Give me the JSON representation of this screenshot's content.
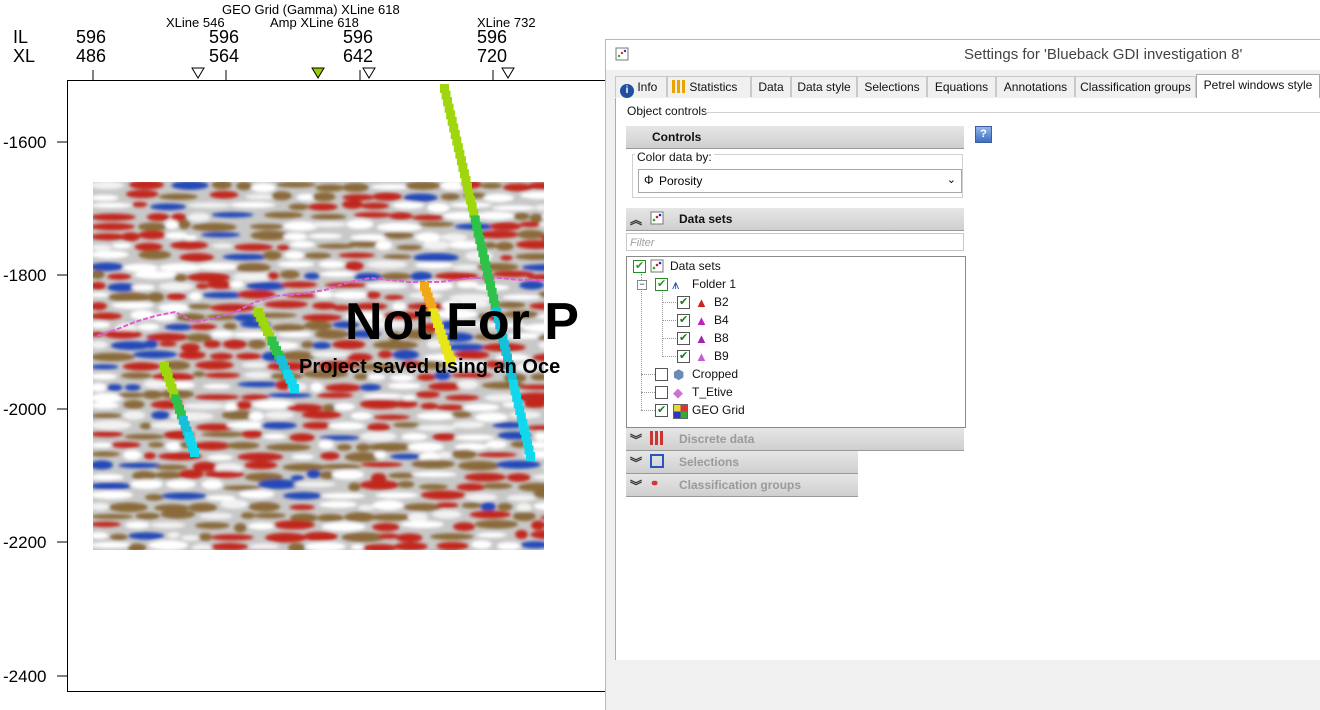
{
  "viewer": {
    "header": {
      "il_label": "IL",
      "xl_label": "XL",
      "columns": [
        {
          "il": "596",
          "xl": "486"
        },
        {
          "il": "596",
          "xl": "564"
        },
        {
          "il": "596",
          "xl": "642"
        },
        {
          "il": "596",
          "xl": "720"
        }
      ],
      "titles": {
        "geo_grid": "GEO Grid (Gamma) XLine 618",
        "xline_546": "XLine 546",
        "amp_xline": "Amp XLine 618",
        "xline_732": "XLine 732"
      }
    },
    "y_axis": {
      "ticks": [
        "-1600",
        "-1800",
        "-2000",
        "-2200",
        "-2400"
      ]
    },
    "watermark": {
      "line1": "Not For P",
      "line2": "Project saved using an Oce"
    },
    "colors": {
      "seismic_red": "#c1271e",
      "seismic_blue": "#2448b8",
      "seismic_brown": "#8a6a3a",
      "horizon": "#e05cd4",
      "marker_active": "#9acd00"
    }
  },
  "dialog": {
    "title": "Settings for 'Blueback GDI investigation 8'",
    "tabs": [
      "Info",
      "Statistics",
      "Data",
      "Data style",
      "Selections",
      "Equations",
      "Annotations",
      "Classification groups",
      "Petrel windows style"
    ],
    "active_tab": "Petrel windows style",
    "group_label": "Object controls",
    "controls_header": "Controls",
    "color_by_legend": "Color data by:",
    "color_by_value": "Porosity",
    "datasets_header": "Data sets",
    "filter_placeholder": "Filter",
    "tree": {
      "root": "Data sets",
      "folder": "Folder 1",
      "wells": [
        "B2",
        "B4",
        "B8",
        "B9"
      ],
      "cropped": "Cropped",
      "t_etive": "T_Etive",
      "geo_grid": "GEO Grid"
    },
    "collapsed_sections": [
      "Discrete data",
      "Selections",
      "Classification groups"
    ],
    "help_glyph": "?"
  }
}
